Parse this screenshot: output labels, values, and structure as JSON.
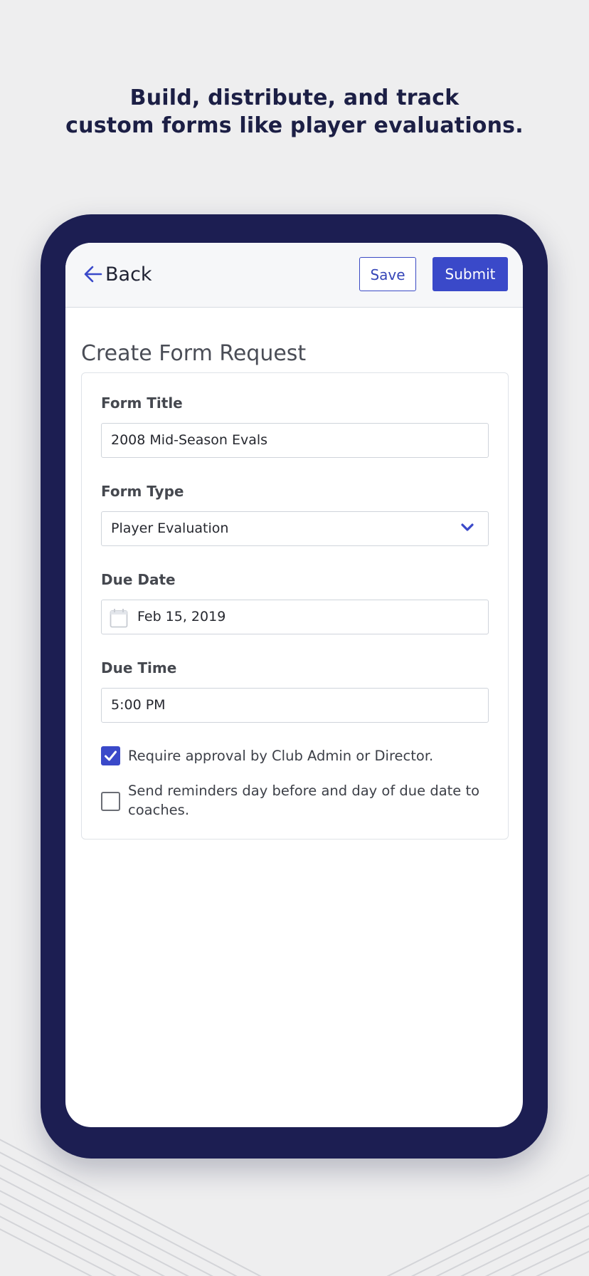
{
  "headline": {
    "line1": "Build, distribute, and track",
    "line2": "custom forms like player evaluations."
  },
  "nav": {
    "back_label": "Back",
    "save_label": "Save",
    "submit_label": "Submit"
  },
  "page_title": "Create Form Request",
  "form": {
    "title_label": "Form Title",
    "title_value": "2008 Mid-Season Evals",
    "type_label": "Form Type",
    "type_value": "Player Evaluation",
    "due_date_label": "Due Date",
    "due_date_value": "Feb 15, 2019",
    "due_time_label": "Due Time",
    "due_time_value": "5:00 PM",
    "approval_text": "Require approval by Club Admin or Director.",
    "approval_checked": true,
    "reminder_text": "Send reminders day before and day of due date to coaches.",
    "reminder_checked": false
  },
  "colors": {
    "accent": "#3a49c9",
    "phone_frame": "#1c1e52",
    "headline": "#1c1f45",
    "background": "#eeeeef"
  },
  "icons": {
    "back": "arrow-left-icon",
    "select": "chevron-down-icon",
    "date": "calendar-icon",
    "checkbox": "checkmark-icon"
  }
}
